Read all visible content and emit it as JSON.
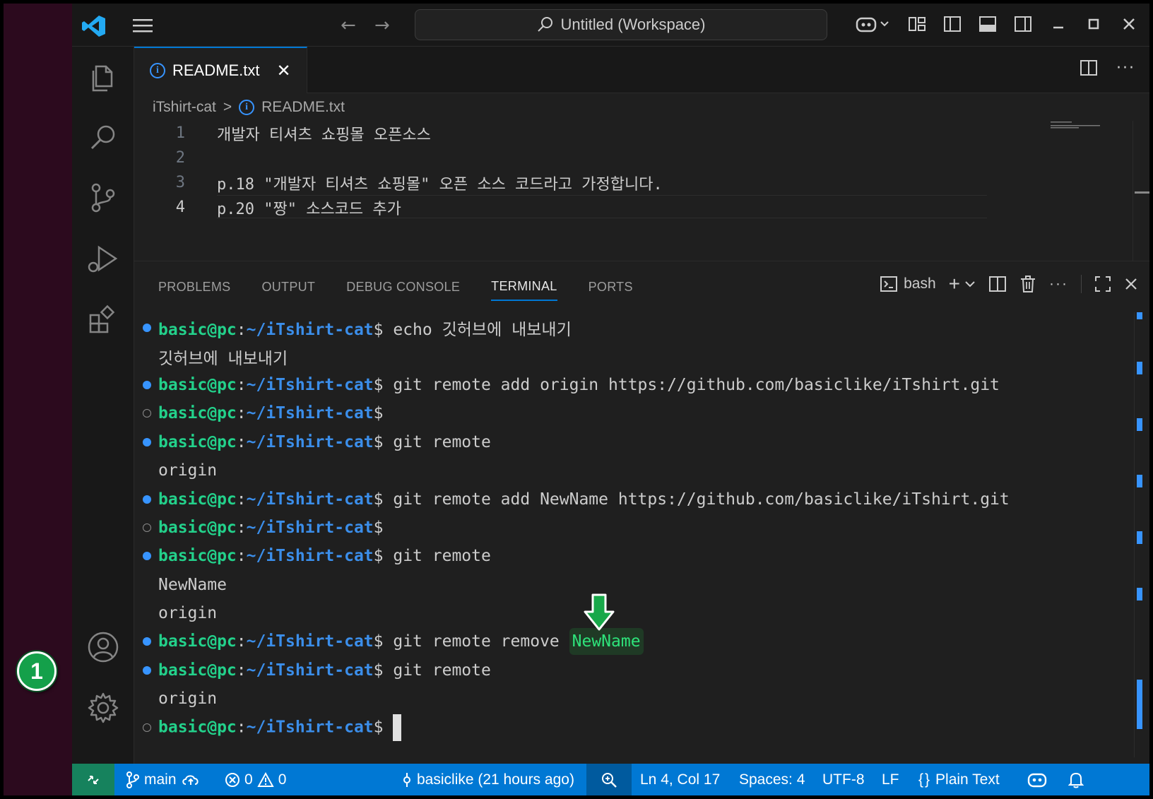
{
  "annotation": {
    "marker": "1"
  },
  "titlebar": {
    "search_text": "Untitled (Workspace)"
  },
  "editor": {
    "tab_label": "README.txt",
    "breadcrumb": {
      "folder": "iTshirt-cat",
      "separator": ">",
      "file": "README.txt"
    },
    "lines": [
      {
        "num": "1",
        "text": "개발자 티셔츠 쇼핑몰 오픈소스"
      },
      {
        "num": "2",
        "text": ""
      },
      {
        "num": "3",
        "text": "p.18 \"개발자 티셔츠 쇼핑몰\" 오픈 소스 코드라고 가정합니다."
      },
      {
        "num": "4",
        "text": "p.20 \"짱\" 소스코드 추가"
      }
    ]
  },
  "panel": {
    "tabs": [
      "PROBLEMS",
      "OUTPUT",
      "DEBUG CONSOLE",
      "TERMINAL",
      "PORTS"
    ],
    "active_tab": "TERMINAL",
    "shell_label": "bash"
  },
  "terminal": {
    "prompt_user": "basic@pc",
    "prompt_colon": ":",
    "prompt_path": "~/iTshirt-cat",
    "prompt_dollar": "$",
    "lines": [
      {
        "kind": "cmd",
        "dot": "blue",
        "cmd": " echo 깃허브에 내보내기"
      },
      {
        "kind": "out",
        "text": "깃허브에 내보내기"
      },
      {
        "kind": "cmd",
        "dot": "blue",
        "cmd": " git remote add origin https://github.com/basiclike/iTshirt.git"
      },
      {
        "kind": "cmd",
        "dot": "empty",
        "cmd": ""
      },
      {
        "kind": "cmd",
        "dot": "blue",
        "cmd": " git remote"
      },
      {
        "kind": "out",
        "text": "origin"
      },
      {
        "kind": "cmd",
        "dot": "blue",
        "cmd": " git remote add NewName https://github.com/basiclike/iTshirt.git"
      },
      {
        "kind": "cmd",
        "dot": "empty",
        "cmd": ""
      },
      {
        "kind": "cmd",
        "dot": "blue",
        "cmd": " git remote"
      },
      {
        "kind": "out",
        "text": "NewName"
      },
      {
        "kind": "out",
        "text": "origin"
      },
      {
        "kind": "cmd",
        "dot": "blue",
        "cmd": " git remote remove ",
        "highlight": "NewName"
      },
      {
        "kind": "cmd",
        "dot": "blue",
        "cmd": " git remote"
      },
      {
        "kind": "out",
        "text": "origin"
      },
      {
        "kind": "cmd",
        "dot": "empty",
        "cmd": " ",
        "cursor": true
      }
    ]
  },
  "statusbar": {
    "branch": "main",
    "errors": "0",
    "warnings": "0",
    "blame": "basiclike (21 hours ago)",
    "position": "Ln 4, Col 17",
    "spaces": "Spaces: 4",
    "encoding": "UTF-8",
    "eol": "LF",
    "language": "Plain Text"
  },
  "colors": {
    "accent": "#0078d4",
    "prompt_user": "#23d18b",
    "prompt_path": "#3b8eea",
    "remote_indicator": "#16825d"
  }
}
